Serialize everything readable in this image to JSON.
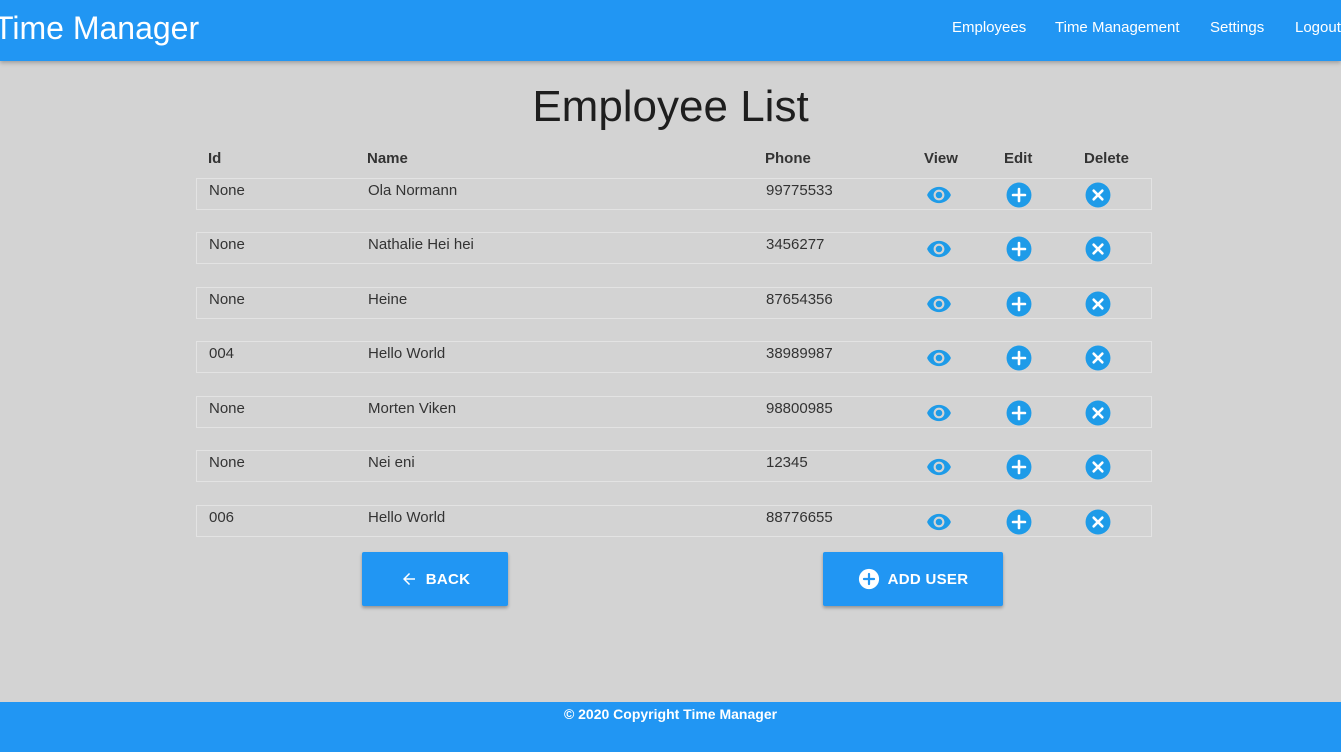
{
  "header": {
    "title": "Time Manager",
    "nav": [
      "Employees",
      "Time Management",
      "Settings",
      "Logout"
    ]
  },
  "page": {
    "title": "Employee List"
  },
  "table": {
    "columns": [
      "Id",
      "Name",
      "Phone",
      "View",
      "Edit",
      "Delete"
    ],
    "rows": [
      {
        "id": "None",
        "name": "Ola Normann",
        "phone": "99775533"
      },
      {
        "id": "None",
        "name": "Nathalie Hei hei",
        "phone": "3456277"
      },
      {
        "id": "None",
        "name": "Heine",
        "phone": "87654356"
      },
      {
        "id": "004",
        "name": "Hello World",
        "phone": "38989987"
      },
      {
        "id": "None",
        "name": "Morten Viken",
        "phone": "98800985"
      },
      {
        "id": "None",
        "name": "Nei eni",
        "phone": "12345"
      },
      {
        "id": "006",
        "name": "Hello World",
        "phone": "88776655"
      }
    ],
    "row_icons": [
      "eye-icon",
      "plus-circle-icon",
      "close-circle-icon"
    ]
  },
  "actions": {
    "back_label": "BACK",
    "back_icon": "arrow-left-icon",
    "add_label": "ADD USER",
    "add_icon": "plus-circle-icon"
  },
  "footer": {
    "text": "© 2020 Copyright Time Manager"
  },
  "colors": {
    "primary": "#2196f3",
    "icon": "#1e9be8",
    "background": "#d3d3d3"
  }
}
